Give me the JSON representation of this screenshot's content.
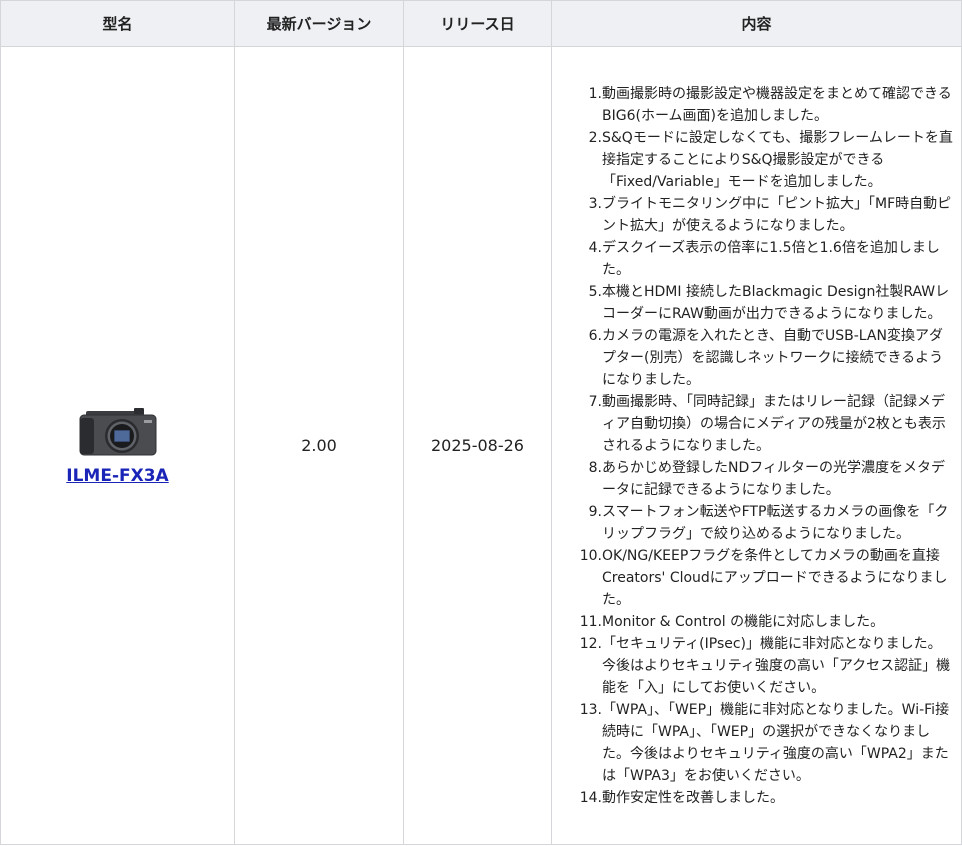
{
  "headers": {
    "model": "型名",
    "version": "最新バージョン",
    "release_date": "リリース日",
    "content": "内容"
  },
  "row": {
    "model_name": "ILME-FX3A",
    "camera_image": "camera-body",
    "version": "2.00",
    "release_date": "2025-08-26",
    "items": [
      {
        "num": "1.",
        "text": "動画撮影時の撮影設定や機器設定をまとめて確認できるBIG6(ホーム画面)を追加しました。"
      },
      {
        "num": "2.",
        "text": "S&Qモードに設定しなくても、撮影フレームレートを直接指定することによりS&Q撮影設定ができる「Fixed/Variable」モードを追加しました。"
      },
      {
        "num": "3.",
        "text": "ブライトモニタリング中に「ピント拡大」「MF時自動ピント拡大」が使えるようになりました。"
      },
      {
        "num": "4.",
        "text": "デスクイーズ表示の倍率に1.5倍と1.6倍を追加しました。"
      },
      {
        "num": "5.",
        "text": "本機とHDMI 接続したBlackmagic Design社製RAWレコーダーにRAW動画が出力できるようになりました。"
      },
      {
        "num": "6.",
        "text": "カメラの電源を入れたとき、自動でUSB-LAN変換アダプター(別売）を認識しネットワークに接続できるようになりました。"
      },
      {
        "num": "7.",
        "text": "動画撮影時、「同時記録」またはリレー記録（記録メディア自動切換）の場合にメディアの残量が2枚とも表示されるようになりました。"
      },
      {
        "num": "8.",
        "text": "あらかじめ登録したNDフィルターの光学濃度をメタデータに記録できるようになりました。"
      },
      {
        "num": "9.",
        "text": "スマートフォン転送やFTP転送するカメラの画像を「クリップフラグ」で絞り込めるようになりました。"
      },
      {
        "num": "10.",
        "text": "OK/NG/KEEPフラグを条件としてカメラの動画を直接Creators' Cloudにアップロードできるようになりました。"
      },
      {
        "num": "11.",
        "text": "Monitor & Control の機能に対応しました。"
      },
      {
        "num": "12.",
        "text": "「セキュリティ(IPsec)」機能に非対応となりました。今後はよりセキュリティ強度の高い「アクセス認証」機能を「入」にしてお使いください。"
      },
      {
        "num": "13.",
        "text": "「WPA」、「WEP」機能に非対応となりました。Wi-Fi接続時に「WPA」、「WEP」の選択ができなくなりました。今後はよりセキュリティ強度の高い「WPA2」または「WPA3」をお使いください。"
      },
      {
        "num": "14.",
        "text": "動作安定性を改善しました。"
      }
    ]
  }
}
